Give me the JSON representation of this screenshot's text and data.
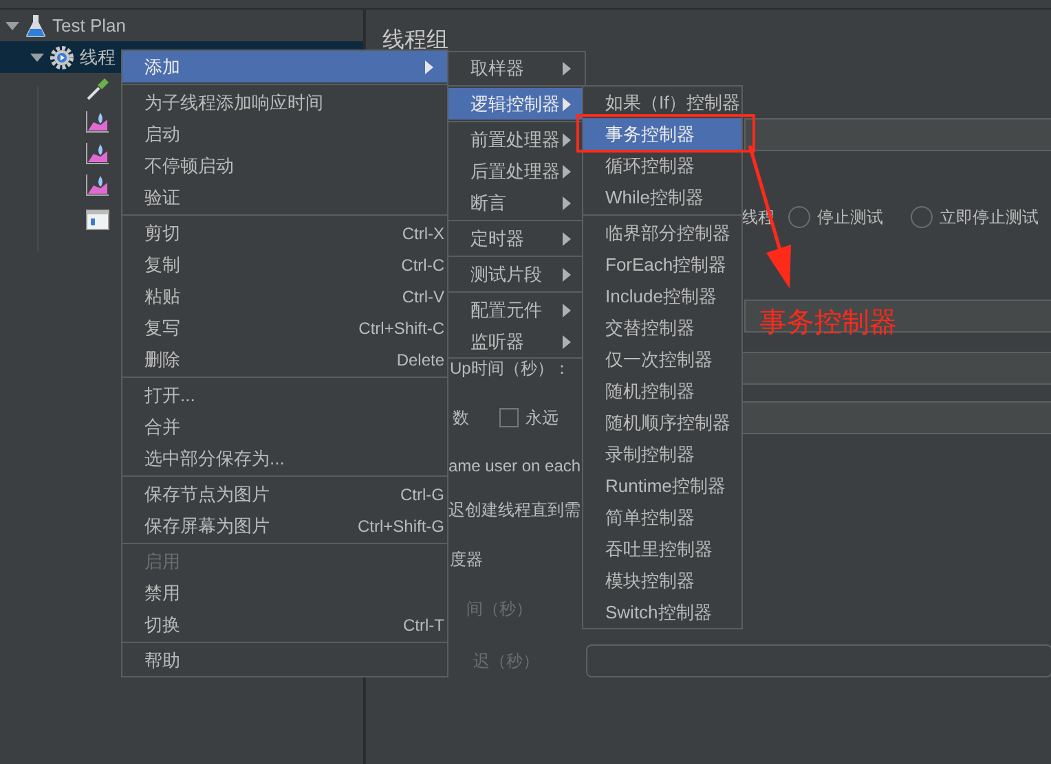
{
  "tree": [
    {
      "label": "Test Plan",
      "kind": "plan",
      "expanded": true,
      "selected": false,
      "children": [
        {
          "label": "线程",
          "kind": "group",
          "expanded": true,
          "selected": true,
          "children": [
            {
              "kind": "sampler"
            },
            {
              "kind": "listener"
            },
            {
              "kind": "listener"
            },
            {
              "kind": "listener"
            },
            {
              "kind": "config"
            }
          ]
        }
      ]
    }
  ],
  "panel": {
    "title": "线程组",
    "rows": [
      {
        "kind": "field"
      },
      {
        "kind": "radios",
        "label": "线程",
        "options": [
          {
            "label": "停止测试",
            "selected": false
          },
          {
            "label": "立即停止测试",
            "selected": false
          }
        ]
      },
      {
        "kind": "field"
      },
      {
        "kind": "label_field",
        "label": "Up时间（秒）：",
        "disabled": false
      },
      {
        "kind": "checkbox_field",
        "label": "数",
        "checkbox": {
          "label": "永远",
          "checked": false
        }
      },
      {
        "kind": "text",
        "label": "ame user on each",
        "disabled": false
      },
      {
        "kind": "text",
        "label": "迟创建线程直到需",
        "disabled": false
      },
      {
        "kind": "text",
        "label": "度器",
        "disabled": false
      },
      {
        "kind": "text",
        "label": "间（秒）",
        "disabled": true
      },
      {
        "kind": "label_field",
        "label": "迟（秒）",
        "disabled": true
      }
    ]
  },
  "menus": [
    {
      "items": [
        {
          "kind": "item",
          "label": "添加",
          "submenu": true,
          "selected": true,
          "disabled": false
        },
        {
          "kind": "separator"
        },
        {
          "kind": "item",
          "label": "为子线程添加响应时间",
          "submenu": false,
          "selected": false,
          "disabled": false
        },
        {
          "kind": "item",
          "label": "启动",
          "submenu": false,
          "selected": false,
          "disabled": false
        },
        {
          "kind": "item",
          "label": "不停顿启动",
          "submenu": false,
          "selected": false,
          "disabled": false
        },
        {
          "kind": "item",
          "label": "验证",
          "submenu": false,
          "selected": false,
          "disabled": false
        },
        {
          "kind": "separator"
        },
        {
          "kind": "item",
          "label": "剪切",
          "shortcut": "Ctrl-X",
          "submenu": false,
          "selected": false,
          "disabled": false
        },
        {
          "kind": "item",
          "label": "复制",
          "shortcut": "Ctrl-C",
          "submenu": false,
          "selected": false,
          "disabled": false
        },
        {
          "kind": "item",
          "label": "粘贴",
          "shortcut": "Ctrl-V",
          "submenu": false,
          "selected": false,
          "disabled": false
        },
        {
          "kind": "item",
          "label": "复写",
          "shortcut": "Ctrl+Shift-C",
          "submenu": false,
          "selected": false,
          "disabled": false
        },
        {
          "kind": "item",
          "label": "删除",
          "shortcut": "Delete",
          "submenu": false,
          "selected": false,
          "disabled": false
        },
        {
          "kind": "separator"
        },
        {
          "kind": "item",
          "label": "打开...",
          "submenu": false,
          "selected": false,
          "disabled": false
        },
        {
          "kind": "item",
          "label": "合并",
          "submenu": false,
          "selected": false,
          "disabled": false
        },
        {
          "kind": "item",
          "label": "选中部分保存为...",
          "submenu": false,
          "selected": false,
          "disabled": false
        },
        {
          "kind": "separator"
        },
        {
          "kind": "item",
          "label": "保存节点为图片",
          "shortcut": "Ctrl-G",
          "submenu": false,
          "selected": false,
          "disabled": false
        },
        {
          "kind": "item",
          "label": "保存屏幕为图片",
          "shortcut": "Ctrl+Shift-G",
          "submenu": false,
          "selected": false,
          "disabled": false
        },
        {
          "kind": "separator"
        },
        {
          "kind": "item",
          "label": "启用",
          "submenu": false,
          "selected": false,
          "disabled": true
        },
        {
          "kind": "item",
          "label": "禁用",
          "submenu": false,
          "selected": false,
          "disabled": false
        },
        {
          "kind": "item",
          "label": "切换",
          "shortcut": "Ctrl-T",
          "submenu": false,
          "selected": false,
          "disabled": false
        },
        {
          "kind": "separator"
        },
        {
          "kind": "item",
          "label": "帮助",
          "submenu": false,
          "selected": false,
          "disabled": false
        }
      ]
    },
    {
      "items": [
        {
          "kind": "item",
          "label": "取样器",
          "submenu": true,
          "selected": false,
          "disabled": false
        },
        {
          "kind": "separator"
        },
        {
          "kind": "item",
          "label": "逻辑控制器",
          "submenu": true,
          "selected": true,
          "disabled": false
        },
        {
          "kind": "separator"
        },
        {
          "kind": "item",
          "label": "前置处理器",
          "submenu": true,
          "selected": false,
          "disabled": false
        },
        {
          "kind": "item",
          "label": "后置处理器",
          "submenu": true,
          "selected": false,
          "disabled": false
        },
        {
          "kind": "item",
          "label": "断言",
          "submenu": true,
          "selected": false,
          "disabled": false
        },
        {
          "kind": "separator"
        },
        {
          "kind": "item",
          "label": "定时器",
          "submenu": true,
          "selected": false,
          "disabled": false
        },
        {
          "kind": "separator"
        },
        {
          "kind": "item",
          "label": "测试片段",
          "submenu": true,
          "selected": false,
          "disabled": false
        },
        {
          "kind": "separator"
        },
        {
          "kind": "item",
          "label": "配置元件",
          "submenu": true,
          "selected": false,
          "disabled": false
        },
        {
          "kind": "item",
          "label": "监听器",
          "submenu": true,
          "selected": false,
          "disabled": false
        }
      ]
    },
    {
      "items": [
        {
          "kind": "item",
          "label": "如果（If）控制器",
          "submenu": false,
          "selected": false,
          "disabled": false
        },
        {
          "kind": "item",
          "label": "事务控制器",
          "submenu": false,
          "selected": true,
          "disabled": false
        },
        {
          "kind": "item",
          "label": "循环控制器",
          "submenu": false,
          "selected": false,
          "disabled": false
        },
        {
          "kind": "item",
          "label": "While控制器",
          "submenu": false,
          "selected": false,
          "disabled": false
        },
        {
          "kind": "separator"
        },
        {
          "kind": "item",
          "label": "临界部分控制器",
          "submenu": false,
          "selected": false,
          "disabled": false
        },
        {
          "kind": "item",
          "label": "ForEach控制器",
          "submenu": false,
          "selected": false,
          "disabled": false
        },
        {
          "kind": "item",
          "label": "Include控制器",
          "submenu": false,
          "selected": false,
          "disabled": false
        },
        {
          "kind": "item",
          "label": "交替控制器",
          "submenu": false,
          "selected": false,
          "disabled": false
        },
        {
          "kind": "item",
          "label": "仅一次控制器",
          "submenu": false,
          "selected": false,
          "disabled": false
        },
        {
          "kind": "item",
          "label": "随机控制器",
          "submenu": false,
          "selected": false,
          "disabled": false
        },
        {
          "kind": "item",
          "label": "随机顺序控制器",
          "submenu": false,
          "selected": false,
          "disabled": false
        },
        {
          "kind": "item",
          "label": "录制控制器",
          "submenu": false,
          "selected": false,
          "disabled": false
        },
        {
          "kind": "item",
          "label": "Runtime控制器",
          "submenu": false,
          "selected": false,
          "disabled": false
        },
        {
          "kind": "item",
          "label": "简单控制器",
          "submenu": false,
          "selected": false,
          "disabled": false
        },
        {
          "kind": "item",
          "label": "吞吐里控制器",
          "submenu": false,
          "selected": false,
          "disabled": false
        },
        {
          "kind": "item",
          "label": "模块控制器",
          "submenu": false,
          "selected": false,
          "disabled": false
        },
        {
          "kind": "item",
          "label": "Switch控制器",
          "submenu": false,
          "selected": false,
          "disabled": false
        }
      ]
    }
  ],
  "annotation": {
    "label": "事务控制器"
  }
}
